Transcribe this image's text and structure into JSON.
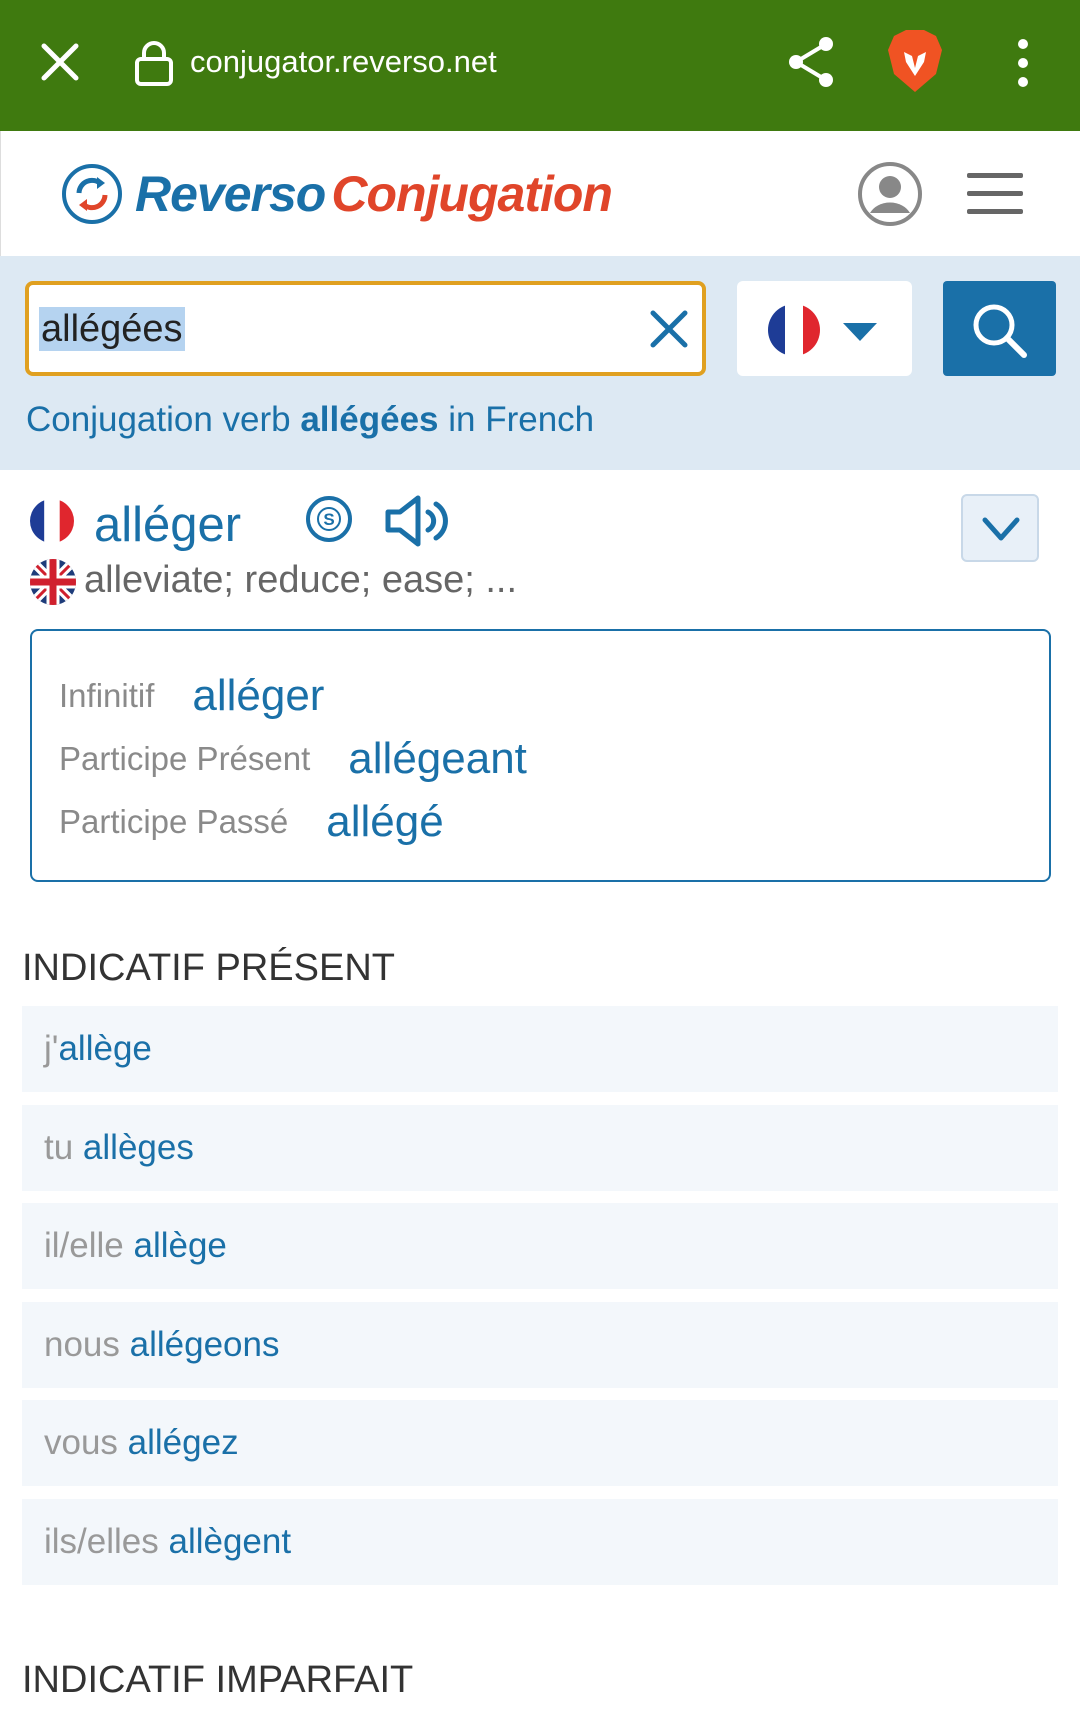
{
  "browser": {
    "url": "conjugator.reverso.net"
  },
  "header": {
    "logo_part1": "Reverso",
    "logo_part2": "Conjugation"
  },
  "search": {
    "value": "allégées",
    "caption_before": "Conjugation verb ",
    "caption_verb": "allégées",
    "caption_after": " in French"
  },
  "verb": {
    "name": "alléger",
    "translation": "alleviate; reduce; ease; ..."
  },
  "forms": [
    {
      "label": "Infinitif",
      "value": "alléger"
    },
    {
      "label": "Participe Présent",
      "value": "allégeant"
    },
    {
      "label": "Participe Passé",
      "value": "allégé"
    }
  ],
  "tenses": [
    {
      "title": "INDICATIF PRÉSENT",
      "rows": [
        {
          "pronoun": "j'",
          "form": "allège"
        },
        {
          "pronoun": "tu ",
          "form": "allèges"
        },
        {
          "pronoun": "il/elle ",
          "form": "allège"
        },
        {
          "pronoun": "nous ",
          "form": "allégeons"
        },
        {
          "pronoun": "vous ",
          "form": "allégez"
        },
        {
          "pronoun": "ils/elles ",
          "form": "allègent"
        }
      ]
    },
    {
      "title": "INDICATIF IMPARFAIT",
      "rows": []
    }
  ],
  "colors": {
    "browser_bar": "#3f7a0f",
    "brand_blue": "#1a70a8",
    "brand_red": "#e0452a",
    "search_highlight": "#e0a020",
    "search_section_bg": "#dde9f3"
  },
  "icons": [
    "close-icon",
    "lock-icon",
    "share-icon",
    "brave-lion-icon",
    "more-vert-icon",
    "reverso-logo-icon",
    "user-icon",
    "hamburger-menu-icon",
    "clear-icon",
    "france-flag-icon",
    "chevron-down-icon",
    "search-icon",
    "s-circle-icon",
    "speaker-icon",
    "uk-flag-icon"
  ]
}
